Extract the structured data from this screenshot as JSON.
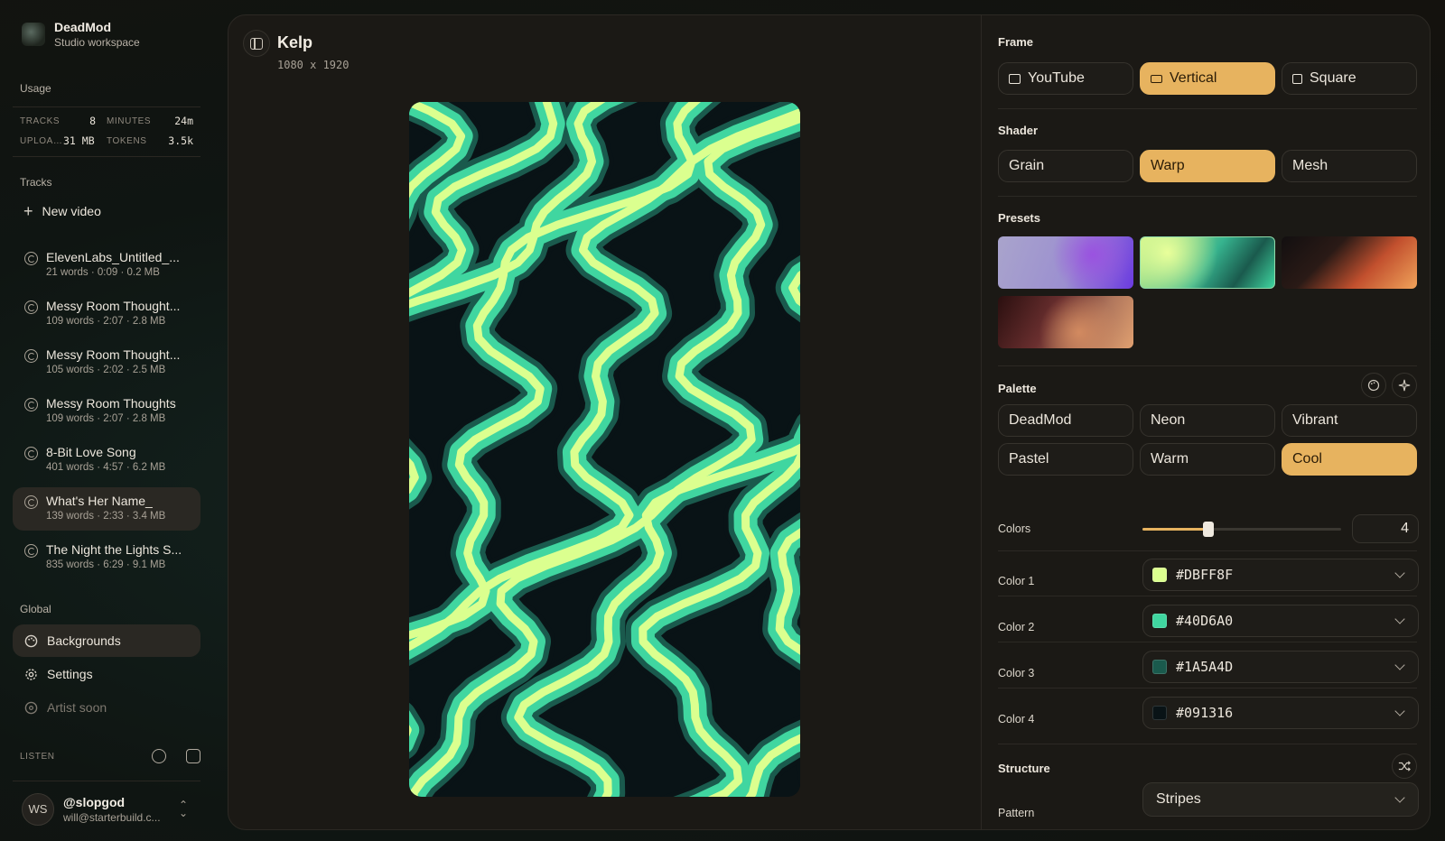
{
  "workspace": {
    "name": "DeadMod",
    "subtitle": "Studio workspace"
  },
  "usage": {
    "label": "Usage",
    "tracks_label": "TRACKS",
    "tracks": "8",
    "minutes_label": "MINUTES",
    "minutes": "24m",
    "uploads_label": "UPLOA…",
    "uploads": "31 MB",
    "tokens_label": "TOKENS",
    "tokens": "3.5k"
  },
  "tracks_section": {
    "label": "Tracks",
    "new_video": "New video",
    "items": [
      {
        "title": "ElevenLabs_Untitled_...",
        "meta": "21 words · 0:09 · 0.2 MB"
      },
      {
        "title": "Messy Room Thought...",
        "meta": "109 words · 2:07 · 2.8 MB"
      },
      {
        "title": "Messy Room Thought...",
        "meta": "105 words · 2:02 · 2.5 MB"
      },
      {
        "title": "Messy Room Thoughts",
        "meta": "109 words · 2:07 · 2.8 MB"
      },
      {
        "title": "8-Bit Love Song",
        "meta": "401 words · 4:57 · 6.2 MB"
      },
      {
        "title": "What's Her Name_",
        "meta": "139 words · 2:33 · 3.4 MB"
      },
      {
        "title": "The Night the Lights S...",
        "meta": "835 words · 6:29 · 9.1 MB"
      }
    ],
    "active_index": 5
  },
  "global": {
    "label": "Global",
    "backgrounds": "Backgrounds",
    "settings": "Settings",
    "artist": "Artist soon"
  },
  "listen": {
    "label": "LISTEN",
    "icons": [
      "spotify-icon",
      "youtube-icon"
    ]
  },
  "user": {
    "initials": "WS",
    "handle": "@slopgod",
    "email": "will@starterbuild.c..."
  },
  "preview": {
    "title": "Kelp",
    "dims": "1080 x 1920"
  },
  "frame": {
    "label": "Frame",
    "options": [
      "YouTube",
      "Vertical",
      "Square"
    ],
    "selected": "Vertical"
  },
  "shader": {
    "label": "Shader",
    "options": [
      "Grain",
      "Warp",
      "Mesh"
    ],
    "selected": "Warp"
  },
  "presets": {
    "label": "Presets"
  },
  "palette": {
    "label": "Palette",
    "options": [
      "DeadMod",
      "Neon",
      "Vibrant",
      "Pastel",
      "Warm",
      "Cool"
    ],
    "selected": "Cool"
  },
  "colors": {
    "label": "Colors",
    "count": "4",
    "slider_fraction": 0.33,
    "items": [
      {
        "label": "Color 1",
        "hex": "#DBFF8F"
      },
      {
        "label": "Color 2",
        "hex": "#40D6A0"
      },
      {
        "label": "Color 3",
        "hex": "#1A5A4D"
      },
      {
        "label": "Color 4",
        "hex": "#091316"
      }
    ]
  },
  "structure": {
    "label": "Structure",
    "pattern_label": "Pattern",
    "pattern": "Stripes"
  },
  "theme": {
    "accent": "#E7B35F"
  }
}
